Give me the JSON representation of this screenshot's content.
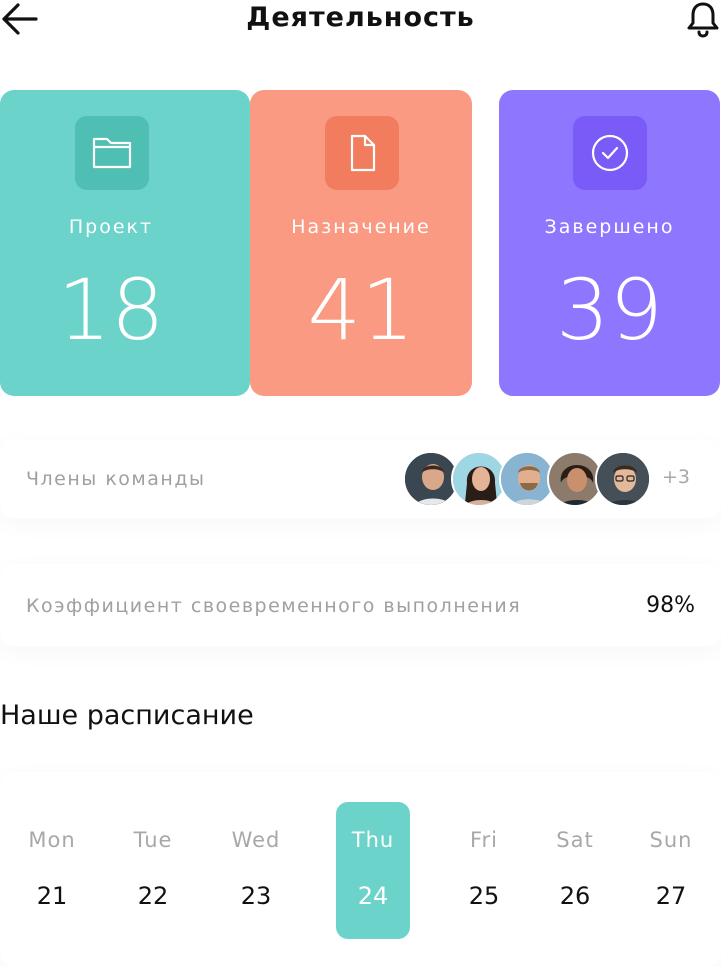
{
  "header": {
    "title": "Деятельность",
    "back_icon": "arrow-left-icon",
    "notification_icon": "bell-icon"
  },
  "stats": [
    {
      "label": "Проект",
      "value": "18",
      "icon": "folder-icon",
      "color": "#6bd3c9"
    },
    {
      "label": "Назначение",
      "value": "41",
      "icon": "document-icon",
      "color": "#fa9a82"
    },
    {
      "label": "Завершено",
      "value": "39",
      "icon": "check-circle-icon",
      "color": "#8e77fe"
    }
  ],
  "team": {
    "label": "Члены команды",
    "more": "+3",
    "avatar_count": 5
  },
  "completion": {
    "label": "Коэффициент своевременного выполнения",
    "value": "98%"
  },
  "schedule": {
    "title": "Наше расписание",
    "selected_index": 3,
    "days": [
      {
        "name": "Mon",
        "num": "21"
      },
      {
        "name": "Tue",
        "num": "22"
      },
      {
        "name": "Wed",
        "num": "23"
      },
      {
        "name": "Thu",
        "num": "24"
      },
      {
        "name": "Fri",
        "num": "25"
      },
      {
        "name": "Sat",
        "num": "26"
      },
      {
        "name": "Sun",
        "num": "27"
      }
    ]
  }
}
